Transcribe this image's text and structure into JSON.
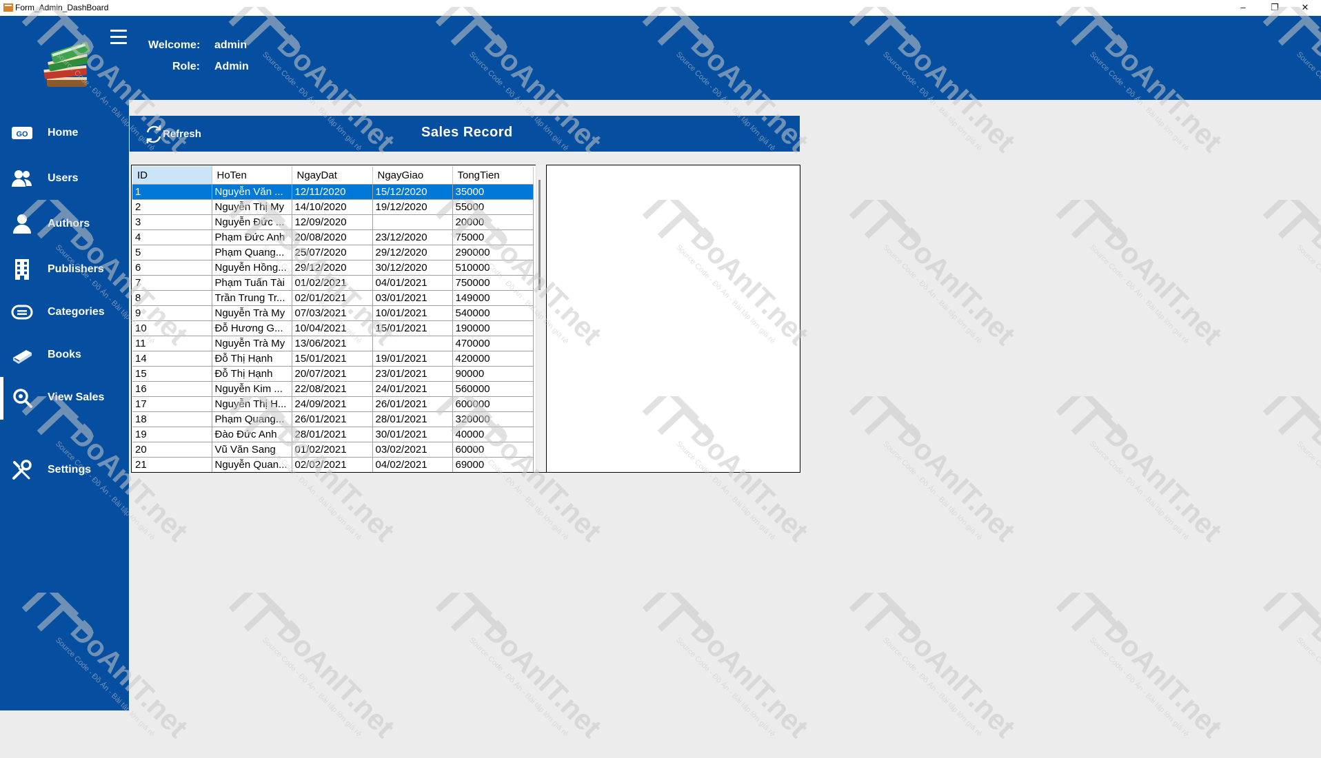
{
  "window": {
    "title": "Form_Admin_DashBoard",
    "minimize_glyph": "–",
    "maximize_glyph": "❐",
    "close_glyph": "✕"
  },
  "header": {
    "welcome_label": "Welcome:",
    "welcome_value": "admin",
    "role_label": "Role:",
    "role_value": "Admin"
  },
  "sidebar": {
    "items": [
      {
        "label": "Home",
        "icon": "home-icon"
      },
      {
        "label": "Users",
        "icon": "users-icon"
      },
      {
        "label": "Authors",
        "icon": "authors-icon"
      },
      {
        "label": "Publishers",
        "icon": "publishers-icon"
      },
      {
        "label": "Categories",
        "icon": "categories-icon"
      },
      {
        "label": "Books",
        "icon": "books-icon"
      },
      {
        "label": "View Sales",
        "icon": "view-sales-icon",
        "active": true
      },
      {
        "label": "Settings",
        "icon": "settings-icon"
      }
    ]
  },
  "sales": {
    "refresh_label": "Refresh",
    "title": "Sales Record",
    "columns": [
      "ID",
      "HoTen",
      "NgayDat",
      "NgayGiao",
      "TongTien"
    ],
    "rows": [
      [
        "1",
        "Nguyễn Văn ...",
        "12/11/2020",
        "15/12/2020",
        "35000"
      ],
      [
        "2",
        "Nguyễn Thị My",
        "14/10/2020",
        "19/12/2020",
        "55000"
      ],
      [
        "3",
        "Nguyễn Đức ...",
        "12/09/2020",
        "",
        "20000"
      ],
      [
        "4",
        "Phạm Đức Anh",
        "20/08/2020",
        "23/12/2020",
        "75000"
      ],
      [
        "5",
        "Phạm Quang...",
        "25/07/2020",
        "29/12/2020",
        "290000"
      ],
      [
        "6",
        "Nguyễn Hồng...",
        "29/12/2020",
        "30/12/2020",
        "510000"
      ],
      [
        "7",
        "Phạm Tuấn Tài",
        "01/02/2021",
        "04/01/2021",
        "750000"
      ],
      [
        "8",
        "Trần Trung Tr...",
        "02/01/2021",
        "03/01/2021",
        "149000"
      ],
      [
        "9",
        "Nguyễn Trà My",
        "07/03/2021",
        "10/01/2021",
        "540000"
      ],
      [
        "10",
        "Đỗ Hương G...",
        "10/04/2021",
        "15/01/2021",
        "190000"
      ],
      [
        "11",
        "Nguyễn Trà My",
        "13/06/2021",
        "",
        "470000"
      ],
      [
        "14",
        "Đỗ Thị Hạnh",
        "15/01/2021",
        "19/01/2021",
        "420000"
      ],
      [
        "15",
        "Đỗ Thị Hạnh",
        "20/07/2021",
        "23/01/2021",
        "90000"
      ],
      [
        "16",
        "Nguyễn Kim ...",
        "22/08/2021",
        "24/01/2021",
        "560000"
      ],
      [
        "17",
        "Nguyễn Thị H...",
        "24/09/2021",
        "26/01/2021",
        "600000"
      ],
      [
        "18",
        "Phạm Quang...",
        "26/01/2021",
        "28/01/2021",
        "320000"
      ],
      [
        "19",
        "Đào Đức Anh",
        "28/01/2021",
        "30/01/2021",
        "40000"
      ],
      [
        "20",
        "Vũ Văn Sang",
        "01/02/2021",
        "03/02/2021",
        "60000"
      ],
      [
        "21",
        "Nguyễn Quan...",
        "02/02/2021",
        "04/02/2021",
        "69000"
      ]
    ]
  },
  "watermark": {
    "brand": "DoAnIT.net",
    "tagline": "Source Code - Đồ Án - Bài tập lớn giá rẻ"
  },
  "colors": {
    "primary": "#054ea0",
    "selection": "#0078d7",
    "background": "#ececec"
  }
}
